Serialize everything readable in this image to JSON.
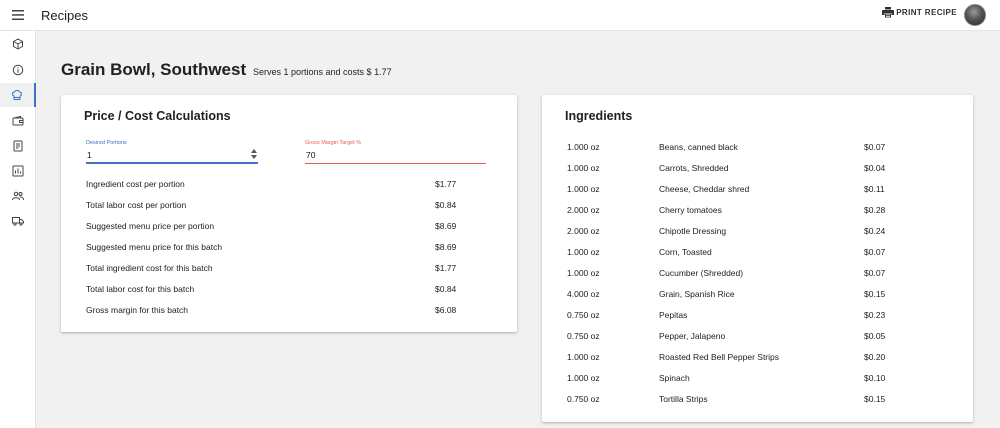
{
  "header": {
    "title": "Recipes",
    "print_label": "PRINT RECIPE"
  },
  "sidebar": {
    "items": [
      {
        "name": "box-icon",
        "active": false
      },
      {
        "name": "info-icon",
        "active": false
      },
      {
        "name": "chef-hat-icon",
        "active": true
      },
      {
        "name": "wallet-icon",
        "active": false
      },
      {
        "name": "document-icon",
        "active": false
      },
      {
        "name": "chart-icon",
        "active": false
      },
      {
        "name": "people-icon",
        "active": false
      },
      {
        "name": "truck-icon",
        "active": false
      }
    ],
    "accent": "#3f6fc6"
  },
  "recipe": {
    "name": "Grain Bowl, Southwest",
    "summary": "Serves 1 portions and costs $ 1.77"
  },
  "price_card": {
    "title": "Price / Cost Calculations",
    "portions_label": "Desired Portions",
    "portions_value": "1",
    "margin_label": "Gross Margin Target %",
    "margin_value": "70",
    "rows": [
      {
        "label": "Ingredient cost per portion",
        "value": "$1.77"
      },
      {
        "label": "Total labor cost per portion",
        "value": "$0.84"
      },
      {
        "label": "Suggested menu price per portion",
        "value": "$8.69"
      },
      {
        "label": "Suggested menu price for this batch",
        "value": "$8.69"
      },
      {
        "label": "Total ingredient cost for this batch",
        "value": "$1.77"
      },
      {
        "label": "Total labor cost for this batch",
        "value": "$0.84"
      },
      {
        "label": "Gross margin for this batch",
        "value": "$6.08"
      }
    ]
  },
  "ingredients_card": {
    "title": "Ingredients",
    "items": [
      {
        "qty": "1.000 oz",
        "name": "Beans, canned black",
        "cost": "$0.07"
      },
      {
        "qty": "1.000 oz",
        "name": "Carrots, Shredded",
        "cost": "$0.04"
      },
      {
        "qty": "1.000 oz",
        "name": "Cheese, Cheddar shred",
        "cost": "$0.11"
      },
      {
        "qty": "2.000 oz",
        "name": "Cherry tomatoes",
        "cost": "$0.28"
      },
      {
        "qty": "2.000 oz",
        "name": "Chipotle Dressing",
        "cost": "$0.24"
      },
      {
        "qty": "1.000 oz",
        "name": "Corn, Toasted",
        "cost": "$0.07"
      },
      {
        "qty": "1.000 oz",
        "name": "Cucumber (Shredded)",
        "cost": "$0.07"
      },
      {
        "qty": "4.000 oz",
        "name": "Grain, Spanish Rice",
        "cost": "$0.15"
      },
      {
        "qty": "0.750 oz",
        "name": "Pepitas",
        "cost": "$0.23"
      },
      {
        "qty": "0.750 oz",
        "name": "Pepper, Jalapeno",
        "cost": "$0.05"
      },
      {
        "qty": "1.000 oz",
        "name": "Roasted Red Bell Pepper Strips",
        "cost": "$0.20"
      },
      {
        "qty": "1.000 oz",
        "name": "Spinach",
        "cost": "$0.10"
      },
      {
        "qty": "0.750 oz",
        "name": "Tortilla Strips",
        "cost": "$0.15"
      }
    ]
  }
}
